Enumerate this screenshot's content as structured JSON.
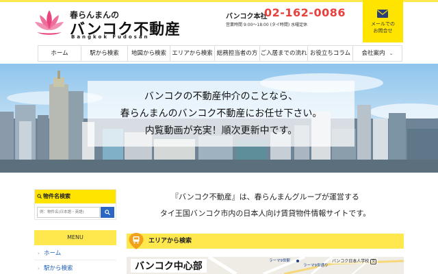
{
  "header": {
    "logo_small": "春らんまんの",
    "logo_main": "バンコク不動産",
    "logo_en": "Bangkok Fudosan",
    "office_label": "バンコク本社",
    "phone": "02-162-0086",
    "hours": "営業時間 9:00～18:00 (タイ時間) 水曜定休",
    "mail_line1": "メールでの",
    "mail_line2": "お問合せ",
    "accent_color": "#ffe400",
    "phone_color": "#e8403c"
  },
  "nav": {
    "items": [
      {
        "label": "ホーム"
      },
      {
        "label": "駅から検索"
      },
      {
        "label": "地図から検索"
      },
      {
        "label": "エリアから検索"
      },
      {
        "label": "総務担当者の方"
      },
      {
        "label": "ご入居までの流れ"
      },
      {
        "label": "お役立ちコラム"
      },
      {
        "label": "会社案内",
        "caret": "⌄"
      }
    ]
  },
  "hero": {
    "line1": "バンコクの不動産仲介のことなら、",
    "line2": "春らんまんのバンコク不動産にお任せ下さい。",
    "line3": "内覧動画が充実！順次更新中です。"
  },
  "sidebar": {
    "search_title": "物件名検索",
    "search_placeholder": "例：物件名(日本語・英語)",
    "menu_title": "MENU",
    "menu_items": [
      {
        "label": "ホーム"
      },
      {
        "label": "駅から検索"
      }
    ]
  },
  "main": {
    "intro_line1": "『バンコク不動産』は、春らんまんグループが運営する",
    "intro_line2": "タイ王国バンコク市内の日本人向け賃貸物件情報サイトです。",
    "area_title": "エリアから検索",
    "map_title": "バンコク中心部",
    "map_label_1": "ラーマ9世駅",
    "map_label_2": "ラーマ9世通り",
    "map_school": "バンコク日本人学校",
    "map_school_mark": "文"
  }
}
